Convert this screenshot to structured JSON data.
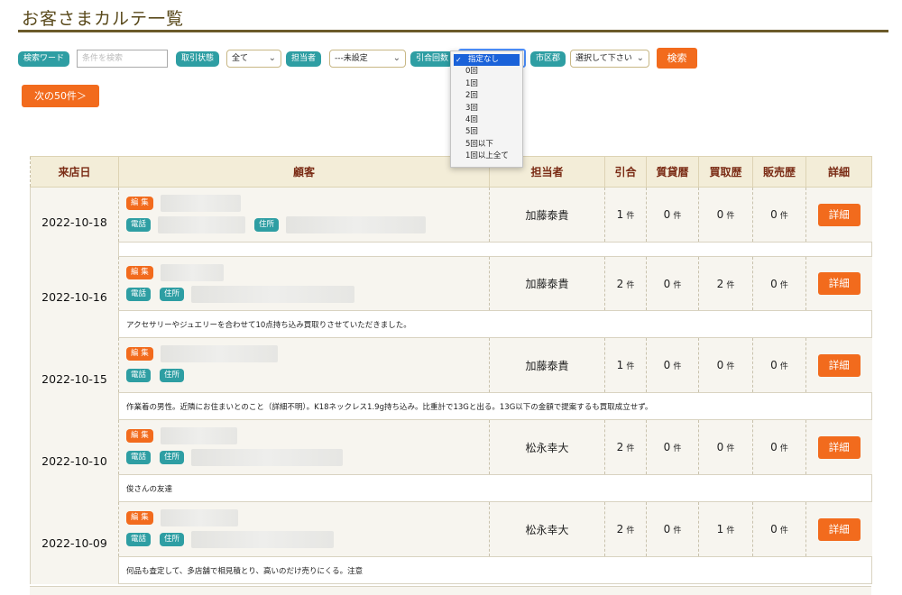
{
  "page": {
    "title": "お客さまカルテ一覧"
  },
  "filters": {
    "keyword_label": "検索ワード",
    "keyword_placeholder": "条件を検索",
    "status_label": "取引状態",
    "status_value": "全て",
    "staff_label": "担当者",
    "staff_value": "---未設定",
    "count_label": "引合回数",
    "count_options": [
      "指定なし",
      "0回",
      "1回",
      "2回",
      "3回",
      "4回",
      "5回",
      "5回以下",
      "1回以上全て"
    ],
    "area_label": "市区郡",
    "area_value": "選択して下さい",
    "search_button": "検索",
    "next_button": "次の50件＞"
  },
  "table": {
    "headers": [
      "来店日",
      "顧客",
      "担当者",
      "引合",
      "質貸暦",
      "買取歴",
      "販売歴",
      "詳細"
    ],
    "edit_tag": "編 集",
    "phone_tag": "電話",
    "address_tag": "住所",
    "unit": "件",
    "detail_button": "詳細",
    "rows": [
      {
        "date": "2022-10-18",
        "staff": "加藤泰貴",
        "inquiry": "1",
        "pawn": "0",
        "purchase": "0",
        "sales": "0",
        "note": ""
      },
      {
        "date": "2022-10-16",
        "staff": "加藤泰貴",
        "inquiry": "2",
        "pawn": "0",
        "purchase": "2",
        "sales": "0",
        "note": "アクセサリーやジュエリーを合わせて10点持ち込み買取りさせていただきました。"
      },
      {
        "date": "2022-10-15",
        "staff": "加藤泰貴",
        "inquiry": "1",
        "pawn": "0",
        "purchase": "0",
        "sales": "0",
        "note": "作業着の男性。近隣にお住まいとのこと（詳細不明）。K18ネックレス1.9g持ち込み。比重計で13Gと出る。13G以下の金額で提案するも買取成立せず。"
      },
      {
        "date": "2022-10-10",
        "staff": "松永幸大",
        "inquiry": "2",
        "pawn": "0",
        "purchase": "0",
        "sales": "0",
        "note": "俊さんの友達"
      },
      {
        "date": "2022-10-09",
        "staff": "松永幸大",
        "inquiry": "2",
        "pawn": "0",
        "purchase": "1",
        "sales": "0",
        "note": "何品も査定して、多店舗で相見積とり、高いのだけ売りにくる。注意"
      }
    ]
  }
}
